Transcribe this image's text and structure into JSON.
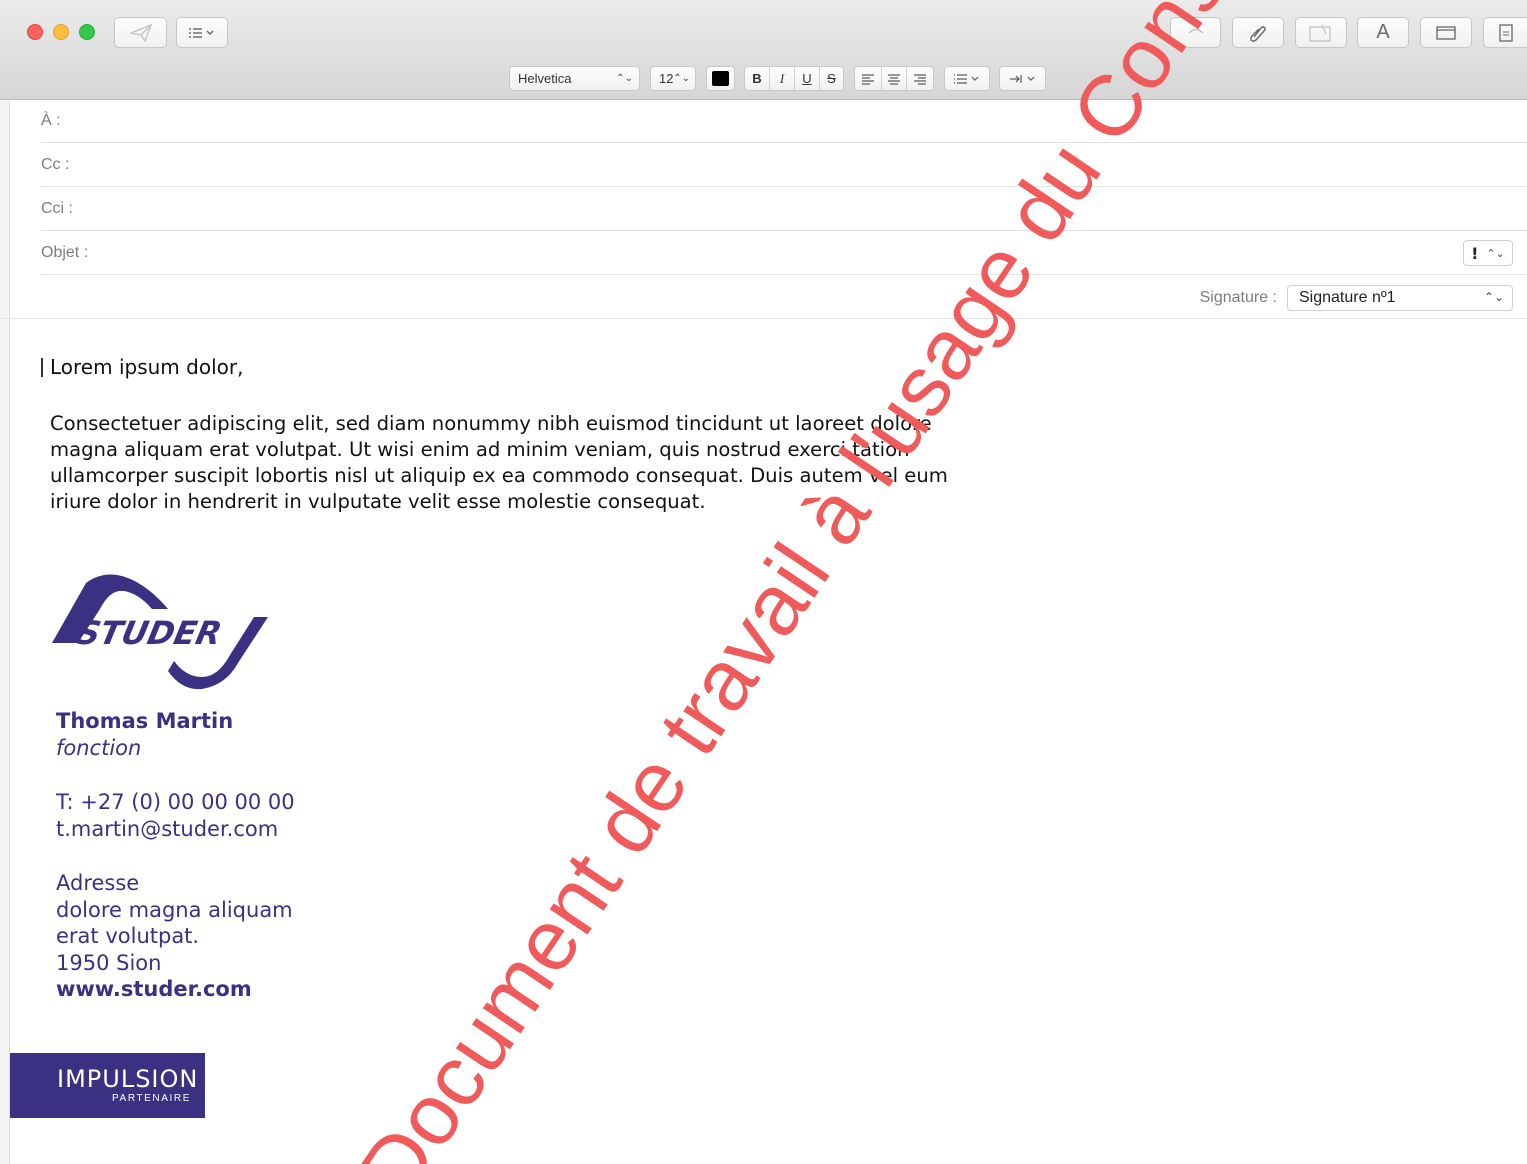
{
  "toolbar": {
    "send_icon": "paper-plane-icon",
    "header_fields_icon": "list-icon",
    "attach_icon": "paperclip-icon",
    "photo_icon": "photo-attach-icon",
    "fonts_label": "A",
    "browser_icon": "window-icon",
    "format_icon": "stationery-icon"
  },
  "format_bar": {
    "font": "Helvetica",
    "size": "12",
    "text_color": "#000000",
    "bold": "B",
    "italic": "I",
    "underline": "U",
    "strike": "S"
  },
  "fields": {
    "to_label": "À :",
    "cc_label": "Cc :",
    "bcc_label": "Cci :",
    "subject_label": "Objet :",
    "priority": "!",
    "signature_label": "Signature :",
    "signature_value": "Signature nº1"
  },
  "message": {
    "greeting": "Lorem ipsum dolor,",
    "body": "Consectetuer adipiscing elit, sed diam nonummy nibh euismod tincidunt ut laoreet dolore magna aliquam erat volutpat. Ut wisi enim ad minim veniam, quis nostrud exerci tation ullamcorper suscipit lobortis nisl ut aliquip ex ea commodo consequat. Duis autem vel eum iriure dolor in hendrerit in vulputate velit esse molestie consequat."
  },
  "signature": {
    "logo_text": "STUDER",
    "name": "Thomas Martin",
    "function": "fonction",
    "phone": "T: +27 (0) 00 00 00 00",
    "email": "t.martin@studer.com",
    "address_title": "Adresse",
    "address_line1": "dolore magna aliquam",
    "address_line2": "erat volutpat.",
    "address_city": "1950 Sion",
    "website": "www.studer.com",
    "badge_title": "IMPULSION",
    "badge_subtitle": "PARTENAIRE",
    "brand_color": "#3b3183"
  },
  "watermark": {
    "text": "Document de travail à l'usage du Conseil général",
    "color": "#f05a5a"
  }
}
